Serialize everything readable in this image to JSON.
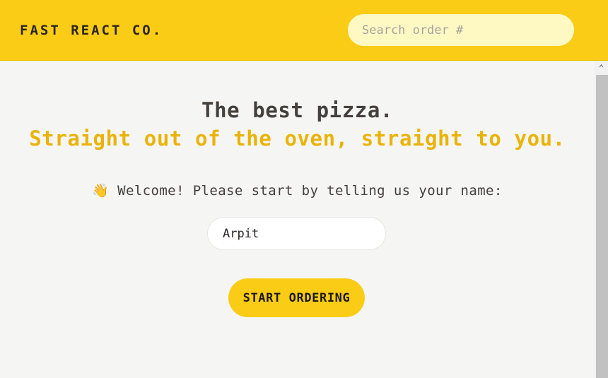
{
  "header": {
    "logo": "FAST REACT CO.",
    "search_placeholder": "Search order #"
  },
  "main": {
    "headline_line1": "The best pizza.",
    "headline_line2": "Straight out of the oven, straight to you.",
    "welcome_text": "👋 Welcome! Please start by telling us your name:",
    "name_value": "Arpit",
    "start_button_label": "START ORDERING"
  },
  "scrollbar": {
    "up_arrow": "⌃"
  },
  "colors": {
    "brand_yellow": "#facc15",
    "accent_yellow_text": "#eab308",
    "search_bg": "#fef9c3",
    "page_bg": "#f5f5f4",
    "text_dark": "#44403c"
  }
}
